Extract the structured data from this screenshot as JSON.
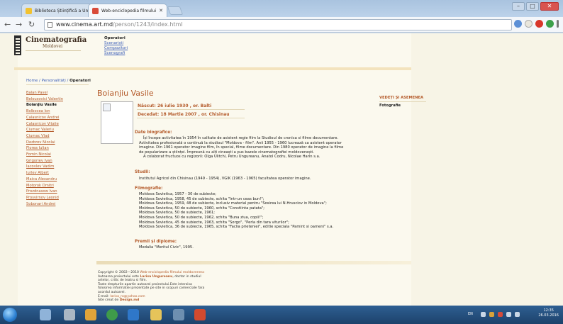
{
  "browser": {
    "tabs": [
      {
        "title": "Biblioteca Științifică a Univ"
      },
      {
        "title": "Web-enciclopedia filmului"
      }
    ],
    "url_host": "www.cinema.art.md",
    "url_path": "/person/1243/index.html"
  },
  "site": {
    "logo_big": "Cinematografia",
    "logo_small": "Moldovei",
    "menu_heading": "Operatori",
    "menu_items": [
      "Scenariști",
      "Compozitori",
      "Scenografi"
    ],
    "breadcrumb": {
      "home": "Home",
      "sep1": " / ",
      "people": "Personalități",
      "sep2": " / ",
      "current": "Operatori"
    },
    "sidebar_people": [
      "Balan Pavel",
      "Belousovici Valentin",
      "Boianjiu Vasile",
      "Bolbocea Ion",
      "Calasnicov Andrei",
      "Calasnicov Vitalie",
      "Ciumac Valeriu",
      "Ciumac Vlad",
      "Dezbrev Nicolai",
      "Florea Iulian",
      "Fomin Nicolai",
      "Grigoriev Ivan",
      "Iacovlev Vadim",
      "Iurlev Albert",
      "Maica Alexandru",
      "Motorok Dmitri",
      "Prozdnasow Ivan",
      "Prosvirnov Leonid",
      "Sobonari Andrei"
    ],
    "current_person_index": 2
  },
  "person": {
    "name": "Boianjiu Vasile",
    "born": "Născut: 26 iulie 1930 , or. Balti",
    "died": "Decedat: 18 Martie 2007 , or. Chisinau",
    "bio_heading": "Date biografice:",
    "bio_lines": [
      "Își începe activitatea în 1954 în calitate de asistent regie film la Studioul de cronica si filme documentare.",
      "Activitatea profesională o continuă la studioul \"Moldova - film\". Anii 1955 - 1960 lucrează ca asistent operator",
      "imagine. Din 1961 operator imagine film, în special, filme documentare. Din 1980 operator de imagine la filme",
      "de popularizare a științei. Împreună cu alți cineaști a pus bazele cinematografiei moldovenești.",
      "A colaborat fructuos cu regizorii: Olga Ulitchi, Petru Ungureanu, Anatol Codru, Nicolae Harin s.a."
    ],
    "studies_heading": "Studii:",
    "studies_text": "Institutul Agricol din Chisinau (1949 - 1954), VGIK (1963 - 1965) facultatea operator imagine.",
    "filmography_heading": "Filmografie:",
    "filmography": [
      "Moldova Sovietica, 1957 - 30 de subiecte;",
      "Moldova Sovietica, 1958, 45 de subiecte, schita \"Intr-un ceas bun!\";",
      "Moldova Sovietica, 1959, 48 de subiecte, inclusiv material pentru \"Sosirea lui N.Hrusciov in Moldova\";",
      "Moldova Sovietica, 50 de subiecte, 1960, schita \"Constiinta patata\";",
      "Moldova Sovietica, 50 de subiecte, 1961;",
      "Moldova Sovietica, 50 de subiecte, 1962, schita \"Buna ziua, copii!\";",
      "Moldova Sovietica, 45 de subiecte, 1963, schita \"Sorgo\", \"Perla din tara viturilor\";",
      "Moldova Sovietica, 36 de subiecte, 1965, schita \"Faclia prieteniei\", editie speciala \"Pamint si oameni\" s.a."
    ],
    "awards_heading": "Premii și diplome:",
    "awards_text": "Medalia \"Meritul Civic\", 1995."
  },
  "rightcol": {
    "heading": "VEDEȚI ȘI ASEMENEA",
    "item": "Fotografie"
  },
  "footer": {
    "copyright_prefix": "Copyright © 2002—2010 ",
    "copyright_link": "Web-enciclopedia filmului moldovenesc",
    "line2_prefix": "Autoarea proiectului este ",
    "line2_name": "Larisa Ungureanu",
    "line2_suffix": ", doctor in studiul",
    "line3": "artelor, critic de teatru si film.",
    "line4": "Toate drepturile apartin autoarei proiectului.Este interzisa",
    "line5": "folosirea informatiei prezentate pe site in scopuri comerciale fara",
    "line6": "acordul autoarei.",
    "email_label": "E-mail: ",
    "email": "larisa_ro@yahoo.com",
    "credit_prefix": "Site creat de ",
    "credit_link": "Design.md"
  },
  "taskbar": {
    "lang": "EN",
    "time": "12:35",
    "date": "26.03.2016"
  }
}
